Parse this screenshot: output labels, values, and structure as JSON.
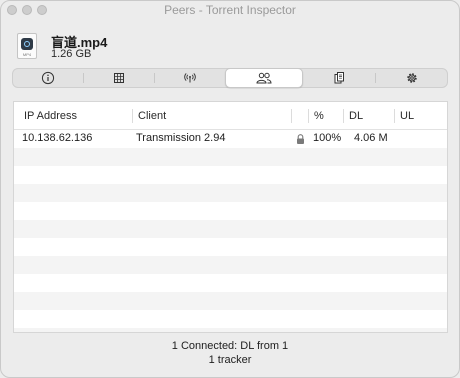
{
  "window": {
    "title": "Peers - Torrent Inspector"
  },
  "file": {
    "name": "盲道.mp4",
    "size": "1.26 GB",
    "icon": "quicktime-movie-icon",
    "icon_label": "MP4"
  },
  "tabs": [
    {
      "name": "info",
      "icon": "info-icon",
      "active": false
    },
    {
      "name": "activity",
      "icon": "grid-icon",
      "active": false
    },
    {
      "name": "trackers",
      "icon": "antenna-icon",
      "active": false
    },
    {
      "name": "peers",
      "icon": "people-icon",
      "active": true
    },
    {
      "name": "files",
      "icon": "documents-icon",
      "active": false
    },
    {
      "name": "options",
      "icon": "gear-icon",
      "active": false
    }
  ],
  "table": {
    "headers": {
      "ip": "IP Address",
      "client": "Client",
      "percent": "%",
      "dl": "DL",
      "ul": "UL"
    },
    "rows": [
      {
        "ip": "10.138.62.136",
        "client": "Transmission 2.94",
        "encrypted": true,
        "percent": "100%",
        "dl": "4.06 M",
        "ul": ""
      }
    ]
  },
  "status": {
    "line1": "1 Connected: DL from 1",
    "line2": "1 tracker"
  }
}
